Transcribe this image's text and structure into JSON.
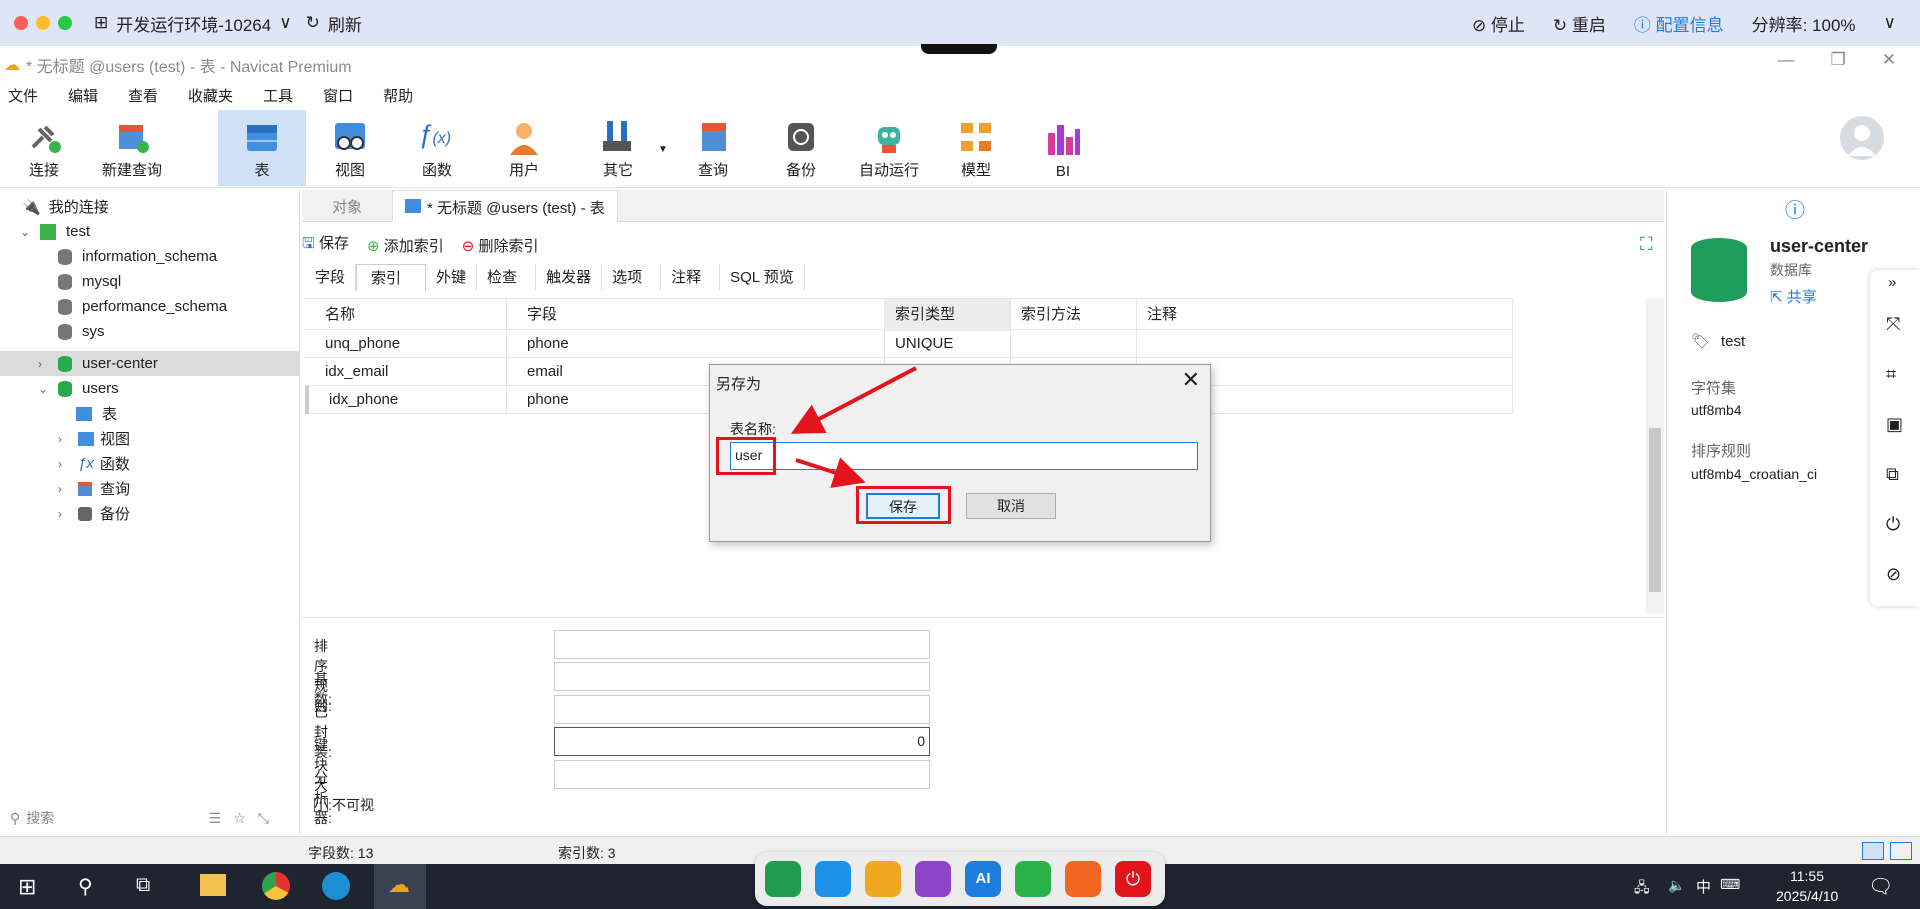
{
  "remote": {
    "title": "开发运行环境-10264",
    "refresh": "刷新",
    "stop": "停止",
    "restart": "重启",
    "config": "配置信息",
    "resolution": "分辨率: 100%"
  },
  "window": {
    "title": "* 无标题 @users (test) - 表 - Navicat Premium"
  },
  "menu": [
    "文件",
    "编辑",
    "查看",
    "收藏夹",
    "工具",
    "窗口",
    "帮助"
  ],
  "toolbar": [
    "连接",
    "新建查询",
    "表",
    "视图",
    "函数",
    "用户",
    "其它",
    "查询",
    "备份",
    "自动运行",
    "模型",
    "BI"
  ],
  "tree": {
    "root": "我的连接",
    "conn": "test",
    "dbs": [
      "information_schema",
      "mysql",
      "performance_schema",
      "sys",
      "user-center",
      "users"
    ],
    "children": [
      "表",
      "视图",
      "函数",
      "查询",
      "备份"
    ],
    "search_placeholder": "搜索"
  },
  "tabs": {
    "objects": "对象",
    "active": "* 无标题 @users (test) - 表"
  },
  "subtool": {
    "save": "保存",
    "add_index": "添加索引",
    "delete_index": "删除索引"
  },
  "subtabs": [
    "字段",
    "索引",
    "外键",
    "检查",
    "触发器",
    "选项",
    "注释",
    "SQL 预览"
  ],
  "grid": {
    "headers": [
      "名称",
      "字段",
      "索引类型",
      "索引方法",
      "注释"
    ],
    "rows": [
      [
        "unq_phone",
        "phone",
        "UNIQUE",
        "",
        ""
      ],
      [
        "idx_email",
        "email",
        "",
        "",
        ""
      ],
      [
        "idx_phone",
        "phone",
        "",
        "",
        ""
      ]
    ]
  },
  "props": {
    "labels": [
      "排序规则:",
      "基数:",
      "已封装:",
      "键块大小:",
      "分析器:"
    ],
    "key_block_value": "0",
    "invisible": "不可视"
  },
  "right": {
    "name": "user-center",
    "type": "数据库",
    "share": "共享",
    "conn": "test",
    "charset_label": "字符集",
    "charset": "utf8mb4",
    "collation_label": "排序规则",
    "collation": "utf8mb4_croatian_ci"
  },
  "status": {
    "fields": "字段数: 13",
    "indexes": "索引数: 3"
  },
  "dialog": {
    "title": "另存为",
    "label": "表名称:",
    "value": "user",
    "save": "保存",
    "cancel": "取消"
  },
  "taskbar": {
    "time": "11:55",
    "date": "2025/4/10",
    "ime": "中"
  },
  "colors": {
    "annotation": "#e3141e",
    "accent": "#1e7ee0"
  }
}
